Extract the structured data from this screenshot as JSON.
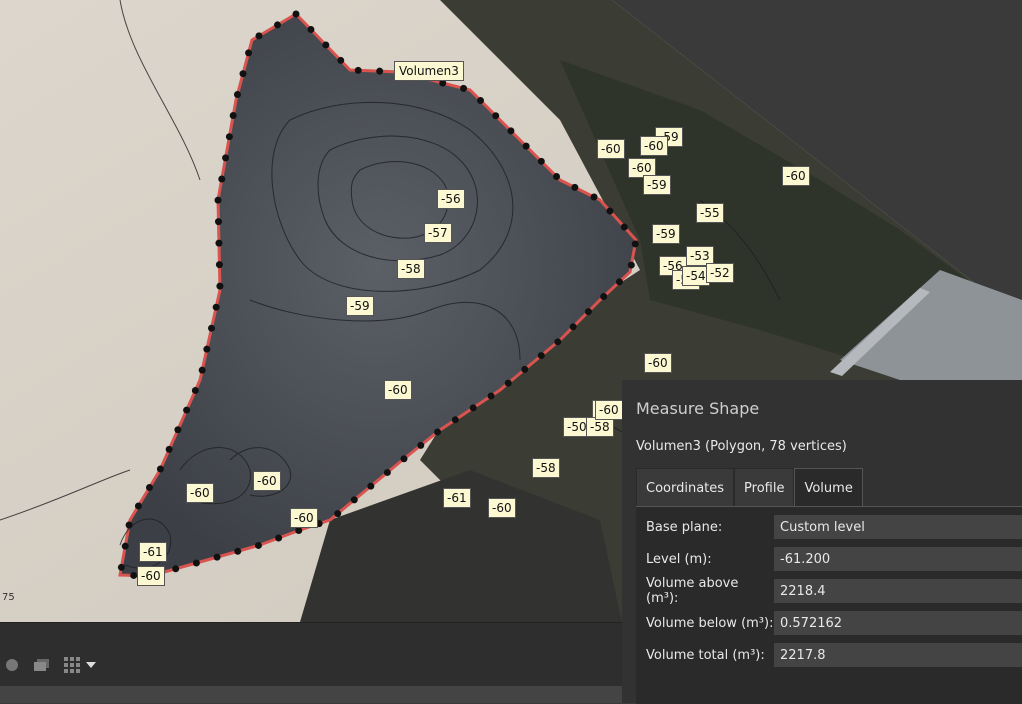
{
  "map": {
    "shape_label": "Volumen3",
    "contour_labels": [
      "-60",
      "-59",
      "-60",
      "-59",
      "-60",
      "-60",
      "-56",
      "-57",
      "-58",
      "-59",
      "-60",
      "-59",
      "-55",
      "-53",
      "-56",
      "-53",
      "-54",
      "-52",
      "-60",
      "-60",
      "-50",
      "-58",
      "-58",
      "-61",
      "-60",
      "-60",
      "-60",
      "-60",
      "-61",
      "-60",
      "-60"
    ],
    "edge_text": "75"
  },
  "toolbar": {
    "icons": [
      "circle-icon",
      "layers-icon",
      "grid-icon",
      "dropdown-arrow-icon"
    ]
  },
  "panel": {
    "title": "Measure Shape",
    "subtitle": "Volumen3 (Polygon, 78 vertices)",
    "tabs": [
      "Coordinates",
      "Profile",
      "Volume"
    ],
    "active_tab": "Volume",
    "fields": [
      {
        "label": "Base plane:",
        "value": "Custom level"
      },
      {
        "label": "Level (m):",
        "value": "-61.200"
      },
      {
        "label": "Volume above (m³):",
        "value": "2218.4"
      },
      {
        "label": "Volume below (m³):",
        "value": "0.572162"
      },
      {
        "label": "Volume total (m³):",
        "value": "2217.8"
      }
    ]
  }
}
